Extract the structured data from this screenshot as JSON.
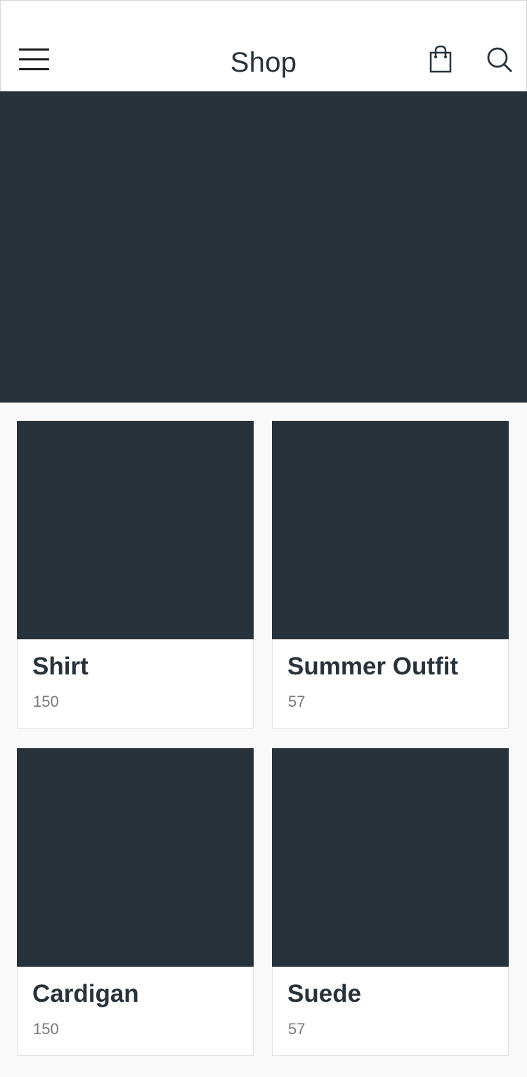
{
  "header": {
    "title": "Shop",
    "icons": {
      "menu": "hamburger-menu-icon",
      "cart": "shopping-bag-icon",
      "search": "search-icon"
    }
  },
  "colors": {
    "placeholder": "#28323a",
    "text": "#29323a",
    "muted": "#7a7a7a",
    "background": "#f9f9f9"
  },
  "categories": [
    {
      "name": "Shirt",
      "count": "150"
    },
    {
      "name": "Summer Outfit",
      "count": "57"
    },
    {
      "name": "Cardigan",
      "count": "150"
    },
    {
      "name": "Suede",
      "count": "57"
    }
  ]
}
